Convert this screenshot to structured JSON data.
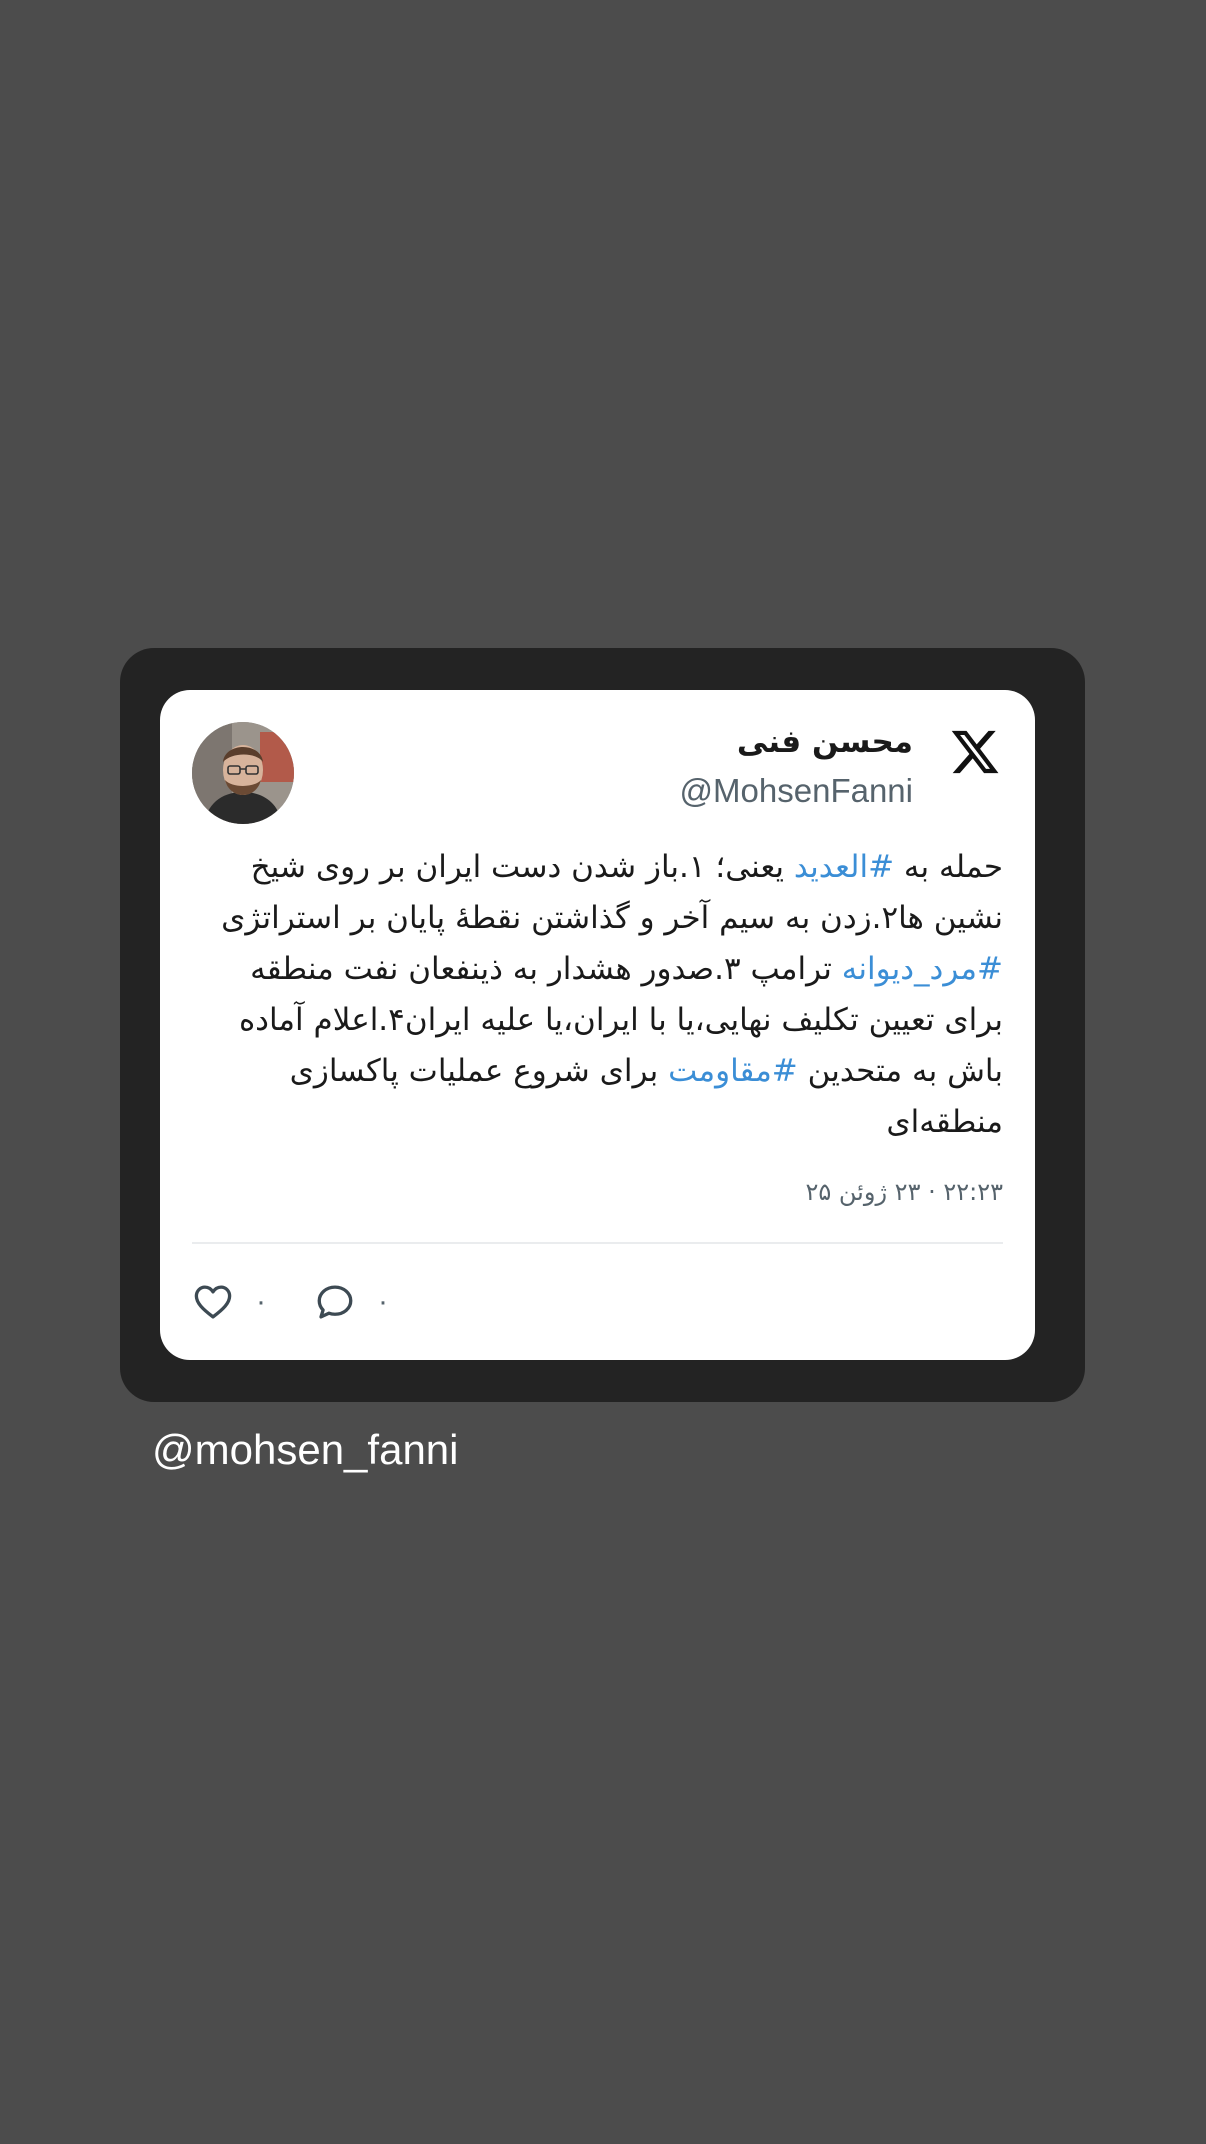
{
  "tweet": {
    "display_name": "محسن فنی",
    "handle": "@MohsenFanni",
    "text_segments": [
      {
        "text": "حمله به ",
        "hashtag": false
      },
      {
        "text": "#العدید",
        "hashtag": true
      },
      {
        "text": " یعنی؛ ۱.باز شدن دست ایران بر روی شیخ نشین ها۲.زدن به سیم آخر و گذاشتن نقطۀ پایان بر استراتژی ",
        "hashtag": false
      },
      {
        "text": "#مرد_دیوانه",
        "hashtag": true
      },
      {
        "text": " ترامپ ۳.صدور هشدار به ذینفعان نفت منطقه برای تعیین تکلیف نهایی،یا با ایران،یا علیه ایران۴.اعلام آماده باش به متحدین ",
        "hashtag": false
      },
      {
        "text": "#مقاومت",
        "hashtag": true
      },
      {
        "text": " برای شروع عملیات پاکسازی منطقه‌ای",
        "hashtag": false
      }
    ],
    "timestamp": "۲۲:۲۳ · ۲۳ ژوئن ۲۵",
    "likes": "۰",
    "replies": "۰"
  },
  "watermark": "@mohsen_fanni",
  "icons": {
    "platform": "x-logo-icon",
    "like": "heart-icon",
    "reply": "reply-bubble-icon"
  },
  "colors": {
    "background": "#4c4c4c",
    "frame": "#232323",
    "card": "#ffffff",
    "hashtag": "#3b8ed6",
    "muted_text": "#56636c"
  }
}
